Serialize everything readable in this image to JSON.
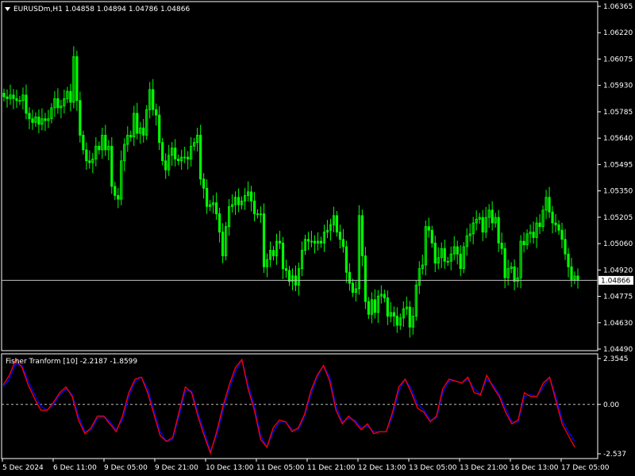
{
  "colors": {
    "background": "#000000",
    "frame": "#ffffff",
    "candle": "#00ff00",
    "price_line": "#c0c0c0",
    "fisher_main": "#ff0000",
    "fisher_signal": "#0000ff",
    "zero_line": "#c0c0c0",
    "text": "#ffffff",
    "price_tag_bg": "#ffffff",
    "price_tag_text": "#000000"
  },
  "icons": {
    "menu": "triangle-down-icon"
  },
  "chart_data": [
    {
      "type": "candlestick",
      "title": "EURUSDm,H1  1.04858 1.04894 1.04786 1.04866",
      "current_price": 1.04866,
      "current_price_label": "1.04866",
      "ylim": [
        1.0449,
        1.06365
      ],
      "y_ticks": [
        "1.06365",
        "1.06220",
        "1.06075",
        "1.05930",
        "1.05785",
        "1.05640",
        "1.05495",
        "1.05350",
        "1.05205",
        "1.05060",
        "1.04920",
        "1.04775",
        "1.04630",
        "1.04490"
      ],
      "x_ticks": [
        "5 Dec 2024",
        "6 Dec 11:00",
        "9 Dec 05:00",
        "9 Dec 21:00",
        "10 Dec 13:00",
        "11 Dec 05:00",
        "11 Dec 21:00",
        "12 Dec 13:00",
        "13 Dec 05:00",
        "13 Dec 21:00",
        "16 Dec 13:00",
        "17 Dec 05:00"
      ],
      "close": [
        1.0587,
        1.0586,
        1.0588,
        1.0586,
        1.0585,
        1.0585,
        1.0588,
        1.0578,
        1.0575,
        1.0573,
        1.0576,
        1.0572,
        1.0575,
        1.0574,
        1.0575,
        1.0581,
        1.0586,
        1.0581,
        1.0582,
        1.0586,
        1.059,
        1.0584,
        1.0609,
        1.0585,
        1.0566,
        1.0558,
        1.0552,
        1.0551,
        1.0553,
        1.056,
        1.0558,
        1.0566,
        1.0558,
        1.056,
        1.0538,
        1.0533,
        1.0531,
        1.0552,
        1.0561,
        1.0566,
        1.0565,
        1.0578,
        1.0567,
        1.057,
        1.0566,
        1.058,
        1.0591,
        1.058,
        1.0577,
        1.0562,
        1.0552,
        1.0547,
        1.0555,
        1.0559,
        1.0553,
        1.0552,
        1.0554,
        1.0554,
        1.0553,
        1.056,
        1.0562,
        1.0566,
        1.0542,
        1.0537,
        1.0527,
        1.0528,
        1.0529,
        1.0523,
        1.0513,
        1.05,
        1.0516,
        1.0527,
        1.0528,
        1.0532,
        1.0528,
        1.053,
        1.0533,
        1.0535,
        1.053,
        1.0523,
        1.0523,
        1.0523,
        1.0494,
        1.0498,
        1.0503,
        1.05,
        1.0508,
        1.0507,
        1.0493,
        1.0492,
        1.0486,
        1.0489,
        1.0484,
        1.0493,
        1.0503,
        1.0509,
        1.0508,
        1.0508,
        1.0507,
        1.0508,
        1.0507,
        1.0513,
        1.0514,
        1.0517,
        1.0522,
        1.0513,
        1.0509,
        1.0505,
        1.0491,
        1.0485,
        1.048,
        1.0482,
        1.0522,
        1.05,
        1.0475,
        1.0468,
        1.0476,
        1.0469,
        1.0478,
        1.0479,
        1.0477,
        1.0467,
        1.0469,
        1.0467,
        1.0462,
        1.0466,
        1.0471,
        1.0472,
        1.0461,
        1.0467,
        1.0484,
        1.0493,
        1.0495,
        1.0516,
        1.0514,
        1.0507,
        1.0496,
        1.0499,
        1.0504,
        1.0497,
        1.0497,
        1.0501,
        1.0505,
        1.0501,
        1.0493,
        1.0505,
        1.0511,
        1.0512,
        1.0518,
        1.052,
        1.0521,
        1.0513,
        1.0521,
        1.0525,
        1.0518,
        1.0521,
        1.0507,
        1.0504,
        1.0488,
        1.0493,
        1.0494,
        1.0486,
        1.0488,
        1.0508,
        1.0506,
        1.0512,
        1.0513,
        1.051,
        1.0518,
        1.0516,
        1.0525,
        1.0532,
        1.0524,
        1.0518,
        1.0517,
        1.0514,
        1.0509,
        1.0501,
        1.0494,
        1.0487,
        1.0489,
        1.0487
      ]
    },
    {
      "type": "line",
      "title": "Fisher Tranform [10] -2.2187 -1.8599",
      "ylim": [
        -2.537,
        2.3545
      ],
      "y_ticks": [
        "2.3545",
        "0.00",
        "-2.537"
      ],
      "zero_line": 0,
      "series": [
        {
          "color": "#ff0000",
          "values": [
            1.0,
            1.5,
            2.3,
            1.9,
            1.0,
            0.3,
            -0.3,
            -0.3,
            0.1,
            0.6,
            0.9,
            0.4,
            -0.8,
            -1.5,
            -1.2,
            -0.6,
            -0.6,
            -1.0,
            -1.4,
            -0.6,
            0.6,
            1.3,
            1.4,
            0.6,
            -0.5,
            -1.6,
            -1.9,
            -1.7,
            -0.4,
            0.9,
            0.6,
            -0.6,
            -1.6,
            -2.5,
            -1.4,
            -0.1,
            1.0,
            1.9,
            2.3,
            0.8,
            -0.3,
            -1.8,
            -2.2,
            -1.2,
            -0.8,
            -0.9,
            -1.4,
            -1.2,
            -0.5,
            0.7,
            1.5,
            2.0,
            1.2,
            -0.3,
            -1.0,
            -0.6,
            -0.9,
            -1.3,
            -1.0,
            -1.5,
            -1.4,
            -1.4,
            -0.4,
            0.9,
            1.3,
            0.6,
            -0.2,
            -0.4,
            -0.9,
            -0.6,
            0.8,
            1.3,
            1.2,
            1.1,
            1.4,
            0.6,
            0.5,
            1.5,
            0.9,
            0.4,
            -0.4,
            -1.0,
            -0.8,
            0.6,
            0.4,
            0.4,
            1.1,
            1.4,
            0.2,
            -1.0,
            -1.6,
            -2.2
          ]
        },
        {
          "color": "#0000ff",
          "values": [
            0.9,
            1.3,
            2.1,
            2.0,
            1.2,
            0.5,
            -0.1,
            -0.3,
            0.0,
            0.5,
            0.8,
            0.5,
            -0.6,
            -1.4,
            -1.3,
            -0.7,
            -0.6,
            -0.9,
            -1.3,
            -0.8,
            0.4,
            1.2,
            1.4,
            0.8,
            -0.3,
            -1.4,
            -1.9,
            -1.8,
            -0.6,
            0.7,
            0.7,
            -0.4,
            -1.4,
            -2.4,
            -1.6,
            -0.3,
            0.8,
            1.7,
            2.3,
            1.0,
            -0.1,
            -1.6,
            -2.2,
            -1.4,
            -0.9,
            -0.9,
            -1.3,
            -1.3,
            -0.6,
            0.5,
            1.4,
            2.0,
            1.4,
            -0.1,
            -0.9,
            -0.7,
            -0.8,
            -1.2,
            -1.1,
            -1.4,
            -1.4,
            -1.4,
            -0.6,
            0.7,
            1.3,
            0.8,
            0.0,
            -0.3,
            -0.8,
            -0.7,
            0.6,
            1.2,
            1.2,
            1.1,
            1.3,
            0.8,
            0.5,
            1.3,
            1.0,
            0.5,
            -0.2,
            -0.9,
            -0.9,
            0.4,
            0.5,
            0.4,
            0.9,
            1.4,
            0.4,
            -0.8,
            -1.4,
            -1.9
          ]
        }
      ]
    }
  ]
}
